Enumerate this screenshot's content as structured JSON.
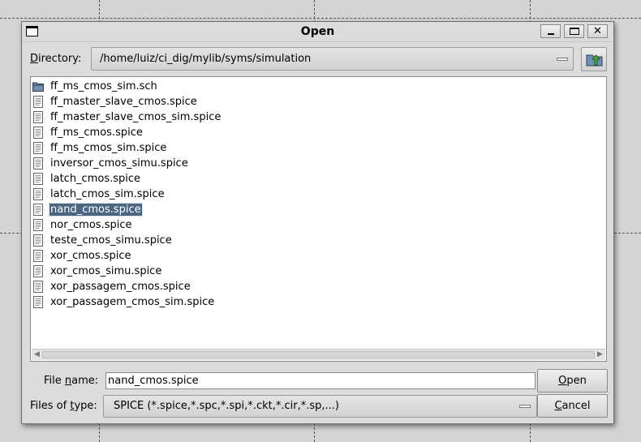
{
  "dialog": {
    "title": "Open",
    "window_buttons": {
      "minimize": "minimize",
      "maximize": "maximize",
      "close": "✕"
    }
  },
  "directory": {
    "label_mnemonic": "D",
    "label_rest": "irectory:",
    "path": "/home/luiz/ci_dig/mylib/syms/simulation"
  },
  "files": [
    {
      "name": "ff_ms_cmos_sim.sch",
      "type": "folder",
      "selected": false
    },
    {
      "name": "ff_master_slave_cmos.spice",
      "type": "file",
      "selected": false
    },
    {
      "name": "ff_master_slave_cmos_sim.spice",
      "type": "file",
      "selected": false
    },
    {
      "name": "ff_ms_cmos.spice",
      "type": "file",
      "selected": false
    },
    {
      "name": "ff_ms_cmos_sim.spice",
      "type": "file",
      "selected": false
    },
    {
      "name": "inversor_cmos_simu.spice",
      "type": "file",
      "selected": false
    },
    {
      "name": "latch_cmos.spice",
      "type": "file",
      "selected": false
    },
    {
      "name": "latch_cmos_sim.spice",
      "type": "file",
      "selected": false
    },
    {
      "name": "nand_cmos.spice",
      "type": "file",
      "selected": true
    },
    {
      "name": "nor_cmos.spice",
      "type": "file",
      "selected": false
    },
    {
      "name": "teste_cmos_simu.spice",
      "type": "file",
      "selected": false
    },
    {
      "name": "xor_cmos.spice",
      "type": "file",
      "selected": false
    },
    {
      "name": "xor_cmos_simu.spice",
      "type": "file",
      "selected": false
    },
    {
      "name": "xor_passagem_cmos.spice",
      "type": "file",
      "selected": false
    },
    {
      "name": "xor_passagem_cmos_sim.spice",
      "type": "file",
      "selected": false
    }
  ],
  "file_name": {
    "label_pre": "File ",
    "label_mnemonic": "n",
    "label_post": "ame:",
    "value": "nand_cmos.spice"
  },
  "file_type": {
    "label_pre": "Files of ",
    "label_mnemonic": "t",
    "label_post": "ype:",
    "value": "SPICE (*.spice,*.spc,*.spi,*.ckt,*.cir,*.sp,...)"
  },
  "buttons": {
    "open_mnemonic": "O",
    "open_rest": "pen",
    "cancel_mnemonic": "C",
    "cancel_rest": "ancel"
  },
  "colors": {
    "selection_bg": "#4a6681",
    "dialog_bg": "#dcdcdc",
    "folder_fill": "#6f8fb4"
  },
  "icons": {
    "window": "window-icon",
    "up_folder": "up-folder-icon",
    "folder": "folder-icon",
    "file": "document-icon"
  }
}
